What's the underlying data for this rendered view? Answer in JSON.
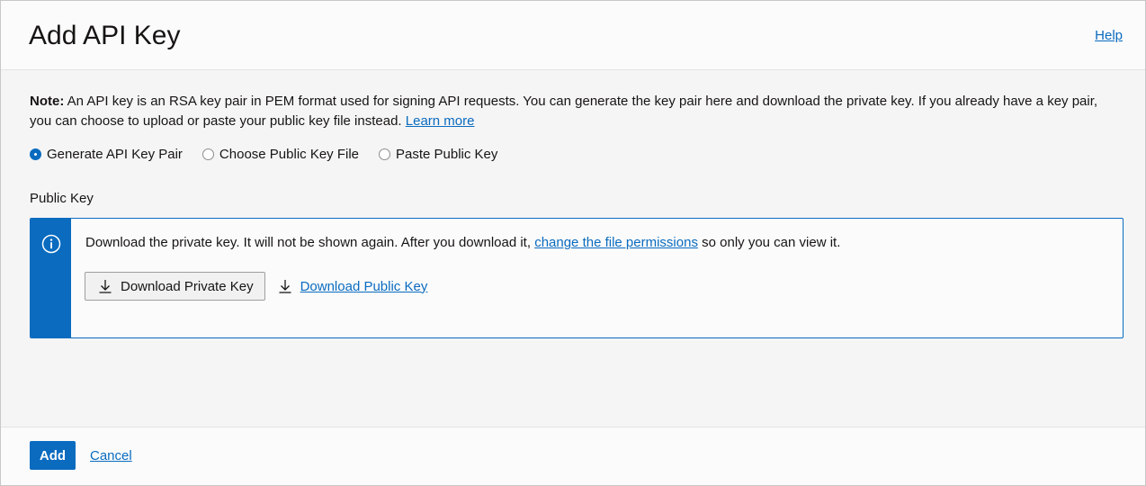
{
  "header": {
    "title": "Add API Key",
    "help_label": "Help"
  },
  "note": {
    "bold_label": "Note:",
    "text": " An API key is an RSA key pair in PEM format used for signing API requests. You can generate the key pair here and download the private key. If you already have a key pair, you can choose to upload or paste your public key file instead. ",
    "learn_more": "Learn more"
  },
  "key_options": {
    "selected": "Generate API Key Pair",
    "options": [
      {
        "label": "Generate API Key Pair",
        "checked": true
      },
      {
        "label": "Choose Public Key File",
        "checked": false
      },
      {
        "label": "Paste Public Key",
        "checked": false
      }
    ]
  },
  "public_key": {
    "section_label": "Public Key",
    "info": {
      "icon": "info-icon",
      "text_before": "Download the private key. It will not be shown again. After you download it, ",
      "link": "change the file permissions",
      "text_after": " so only you can view it."
    },
    "download_private_label": "Download Private Key",
    "download_public_label": "Download Public Key",
    "download_icon": "download-icon"
  },
  "footer": {
    "add_label": "Add",
    "cancel_label": "Cancel"
  },
  "colors": {
    "accent": "#0a6bbf",
    "background": "#f5f5f5",
    "text": "#161513"
  }
}
